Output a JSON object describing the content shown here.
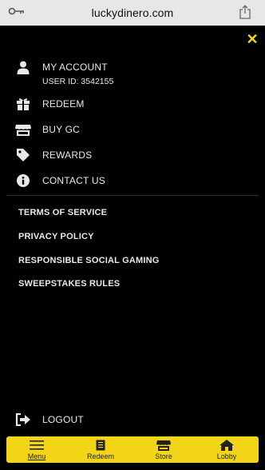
{
  "browser": {
    "url": "luckydinero.com"
  },
  "menu": {
    "account_label": "MY ACCOUNT",
    "user_id": "USER ID: 3542155",
    "redeem_label": "REDEEM",
    "buy_gc_label": "BUY GC",
    "rewards_label": "REWARDS",
    "contact_label": "CONTACT US",
    "logout_label": "LOGOUT"
  },
  "links": {
    "terms": "TERMS OF SERVICE",
    "privacy": "PRIVACY POLICY",
    "responsible": "RESPONSIBLE SOCIAL GAMING",
    "sweepstakes": "SWEEPSTAKES RULES"
  },
  "tabbar": {
    "menu": "Menu",
    "redeem": "Redeem",
    "store": "Store",
    "lobby": "Lobby"
  },
  "colors": {
    "accent": "#f2d516",
    "background": "#000000"
  },
  "icons": [
    "key-icon",
    "share-icon",
    "close-icon",
    "user-icon",
    "gift-icon",
    "store-icon",
    "tag-icon",
    "info-icon",
    "logout-icon",
    "menu-icon",
    "receipt-icon",
    "home-icon"
  ]
}
